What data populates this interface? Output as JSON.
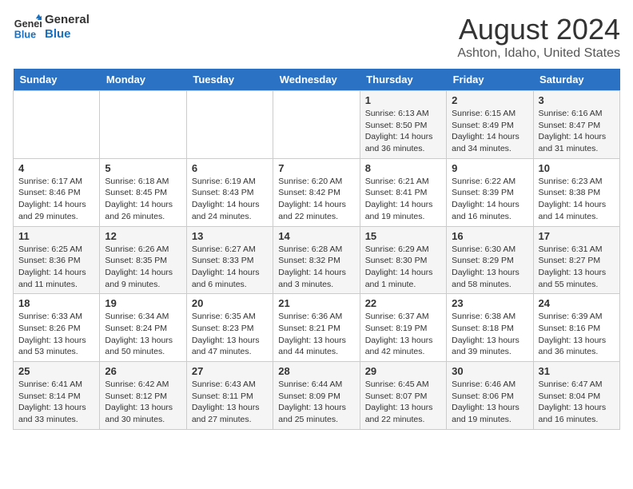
{
  "logo": {
    "line1": "General",
    "line2": "Blue"
  },
  "title": "August 2024",
  "location": "Ashton, Idaho, United States",
  "days_of_week": [
    "Sunday",
    "Monday",
    "Tuesday",
    "Wednesday",
    "Thursday",
    "Friday",
    "Saturday"
  ],
  "weeks": [
    [
      {
        "day": "",
        "info": ""
      },
      {
        "day": "",
        "info": ""
      },
      {
        "day": "",
        "info": ""
      },
      {
        "day": "",
        "info": ""
      },
      {
        "day": "1",
        "info": "Sunrise: 6:13 AM\nSunset: 8:50 PM\nDaylight: 14 hours and 36 minutes."
      },
      {
        "day": "2",
        "info": "Sunrise: 6:15 AM\nSunset: 8:49 PM\nDaylight: 14 hours and 34 minutes."
      },
      {
        "day": "3",
        "info": "Sunrise: 6:16 AM\nSunset: 8:47 PM\nDaylight: 14 hours and 31 minutes."
      }
    ],
    [
      {
        "day": "4",
        "info": "Sunrise: 6:17 AM\nSunset: 8:46 PM\nDaylight: 14 hours and 29 minutes."
      },
      {
        "day": "5",
        "info": "Sunrise: 6:18 AM\nSunset: 8:45 PM\nDaylight: 14 hours and 26 minutes."
      },
      {
        "day": "6",
        "info": "Sunrise: 6:19 AM\nSunset: 8:43 PM\nDaylight: 14 hours and 24 minutes."
      },
      {
        "day": "7",
        "info": "Sunrise: 6:20 AM\nSunset: 8:42 PM\nDaylight: 14 hours and 22 minutes."
      },
      {
        "day": "8",
        "info": "Sunrise: 6:21 AM\nSunset: 8:41 PM\nDaylight: 14 hours and 19 minutes."
      },
      {
        "day": "9",
        "info": "Sunrise: 6:22 AM\nSunset: 8:39 PM\nDaylight: 14 hours and 16 minutes."
      },
      {
        "day": "10",
        "info": "Sunrise: 6:23 AM\nSunset: 8:38 PM\nDaylight: 14 hours and 14 minutes."
      }
    ],
    [
      {
        "day": "11",
        "info": "Sunrise: 6:25 AM\nSunset: 8:36 PM\nDaylight: 14 hours and 11 minutes."
      },
      {
        "day": "12",
        "info": "Sunrise: 6:26 AM\nSunset: 8:35 PM\nDaylight: 14 hours and 9 minutes."
      },
      {
        "day": "13",
        "info": "Sunrise: 6:27 AM\nSunset: 8:33 PM\nDaylight: 14 hours and 6 minutes."
      },
      {
        "day": "14",
        "info": "Sunrise: 6:28 AM\nSunset: 8:32 PM\nDaylight: 14 hours and 3 minutes."
      },
      {
        "day": "15",
        "info": "Sunrise: 6:29 AM\nSunset: 8:30 PM\nDaylight: 14 hours and 1 minute."
      },
      {
        "day": "16",
        "info": "Sunrise: 6:30 AM\nSunset: 8:29 PM\nDaylight: 13 hours and 58 minutes."
      },
      {
        "day": "17",
        "info": "Sunrise: 6:31 AM\nSunset: 8:27 PM\nDaylight: 13 hours and 55 minutes."
      }
    ],
    [
      {
        "day": "18",
        "info": "Sunrise: 6:33 AM\nSunset: 8:26 PM\nDaylight: 13 hours and 53 minutes."
      },
      {
        "day": "19",
        "info": "Sunrise: 6:34 AM\nSunset: 8:24 PM\nDaylight: 13 hours and 50 minutes."
      },
      {
        "day": "20",
        "info": "Sunrise: 6:35 AM\nSunset: 8:23 PM\nDaylight: 13 hours and 47 minutes."
      },
      {
        "day": "21",
        "info": "Sunrise: 6:36 AM\nSunset: 8:21 PM\nDaylight: 13 hours and 44 minutes."
      },
      {
        "day": "22",
        "info": "Sunrise: 6:37 AM\nSunset: 8:19 PM\nDaylight: 13 hours and 42 minutes."
      },
      {
        "day": "23",
        "info": "Sunrise: 6:38 AM\nSunset: 8:18 PM\nDaylight: 13 hours and 39 minutes."
      },
      {
        "day": "24",
        "info": "Sunrise: 6:39 AM\nSunset: 8:16 PM\nDaylight: 13 hours and 36 minutes."
      }
    ],
    [
      {
        "day": "25",
        "info": "Sunrise: 6:41 AM\nSunset: 8:14 PM\nDaylight: 13 hours and 33 minutes."
      },
      {
        "day": "26",
        "info": "Sunrise: 6:42 AM\nSunset: 8:12 PM\nDaylight: 13 hours and 30 minutes."
      },
      {
        "day": "27",
        "info": "Sunrise: 6:43 AM\nSunset: 8:11 PM\nDaylight: 13 hours and 27 minutes."
      },
      {
        "day": "28",
        "info": "Sunrise: 6:44 AM\nSunset: 8:09 PM\nDaylight: 13 hours and 25 minutes."
      },
      {
        "day": "29",
        "info": "Sunrise: 6:45 AM\nSunset: 8:07 PM\nDaylight: 13 hours and 22 minutes."
      },
      {
        "day": "30",
        "info": "Sunrise: 6:46 AM\nSunset: 8:06 PM\nDaylight: 13 hours and 19 minutes."
      },
      {
        "day": "31",
        "info": "Sunrise: 6:47 AM\nSunset: 8:04 PM\nDaylight: 13 hours and 16 minutes."
      }
    ]
  ]
}
